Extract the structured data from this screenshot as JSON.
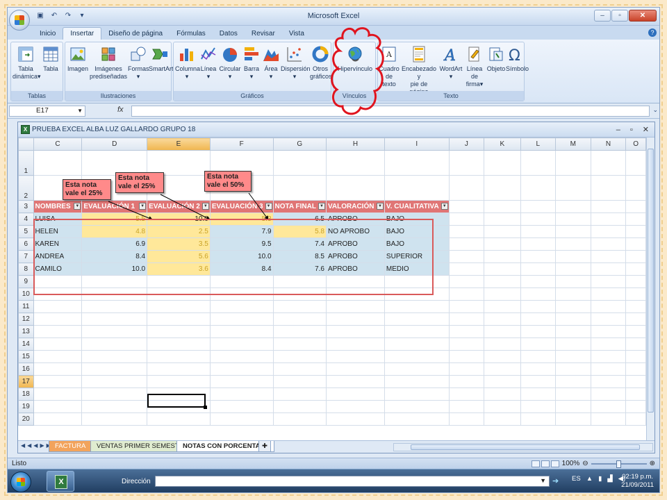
{
  "app": {
    "title": "Microsoft Excel"
  },
  "ribbon": {
    "tabs": [
      "Inicio",
      "Insertar",
      "Diseño de página",
      "Fórmulas",
      "Datos",
      "Revisar",
      "Vista"
    ],
    "active_tab": "Insertar",
    "groups": {
      "tablas": {
        "label": "Tablas",
        "buttons": [
          {
            "line1": "Tabla",
            "line2": "dinámica",
            "dd": "▾"
          },
          {
            "line1": "Tabla",
            "line2": "",
            "dd": ""
          }
        ]
      },
      "ilustraciones": {
        "label": "Ilustraciones",
        "buttons": [
          {
            "line1": "Imagen",
            "line2": "",
            "dd": ""
          },
          {
            "line1": "Imágenes",
            "line2": "prediseñadas",
            "dd": ""
          },
          {
            "line1": "Formas",
            "line2": "",
            "dd": "▾"
          },
          {
            "line1": "SmartArt",
            "line2": "",
            "dd": ""
          }
        ]
      },
      "graficos": {
        "label": "Gráficos",
        "buttons": [
          {
            "line1": "Columna",
            "line2": "",
            "dd": "▾"
          },
          {
            "line1": "Línea",
            "line2": "",
            "dd": "▾"
          },
          {
            "line1": "Circular",
            "line2": "",
            "dd": "▾"
          },
          {
            "line1": "Barra",
            "line2": "",
            "dd": "▾"
          },
          {
            "line1": "Área",
            "line2": "",
            "dd": "▾"
          },
          {
            "line1": "Dispersión",
            "line2": "",
            "dd": "▾"
          },
          {
            "line1": "Otros",
            "line2": "gráficos",
            "dd": "▾"
          }
        ]
      },
      "vinculos": {
        "label": "Vínculos",
        "buttons": [
          {
            "line1": "Hipervínculo",
            "line2": "",
            "dd": ""
          }
        ]
      },
      "texto": {
        "label": "Texto",
        "buttons": [
          {
            "line1": "Cuadro",
            "line2": "de texto",
            "dd": ""
          },
          {
            "line1": "Encabezado y",
            "line2": "pie de página",
            "dd": ""
          },
          {
            "line1": "WordArt",
            "line2": "",
            "dd": "▾"
          },
          {
            "line1": "Línea de",
            "line2": "firma",
            "dd": "▾"
          },
          {
            "line1": "Objeto",
            "line2": "",
            "dd": ""
          },
          {
            "line1": "Símbolo",
            "line2": "",
            "dd": ""
          }
        ]
      }
    }
  },
  "formula_bar": {
    "name_box": "E17",
    "fx": "fx",
    "content": ""
  },
  "workbook": {
    "title": "PRUEBA EXCEL ALBA LUZ GALLARDO GRUPO 18",
    "columns": [
      "C",
      "D",
      "E",
      "F",
      "G",
      "H",
      "I",
      "J",
      "K",
      "L",
      "M",
      "N",
      "O"
    ],
    "rows": [
      "1",
      "2",
      "3",
      "4",
      "5",
      "6",
      "7",
      "8",
      "9",
      "10",
      "11",
      "12",
      "13",
      "14",
      "15",
      "16",
      "17",
      "18",
      "19",
      "20"
    ],
    "selected_row": "17",
    "selected_col": "E",
    "table_headers": [
      "NOMBRES",
      "EVALUACIÓN 1",
      "EVALUACIÓN 2",
      "EVALUACIÓN 3",
      "NOTA FINAL",
      "VALORACIÓN",
      "V. CUALITATIVA"
    ],
    "table_rows": [
      [
        "LUISA",
        "5.5",
        "10.0",
        "5.3",
        "6.5",
        "APROBO",
        "BAJO"
      ],
      [
        "HELEN",
        "4.8",
        "2.5",
        "7.9",
        "5.8",
        "NO APROBO",
        "BAJO"
      ],
      [
        "KAREN",
        "6.9",
        "3.5",
        "9.5",
        "7.4",
        "APROBO",
        "BAJO"
      ],
      [
        "ANDREA",
        "8.4",
        "5.6",
        "10.0",
        "8.5",
        "APROBO",
        "SUPERIOR"
      ],
      [
        "CAMILO",
        "10.0",
        "3.6",
        "8.4",
        "7.6",
        "APROBO",
        "MEDIO"
      ]
    ],
    "callouts": [
      {
        "line1": "Esta nota",
        "line2": "vale el 25%"
      },
      {
        "line1": "Esta nota",
        "line2": "vale el 25%"
      },
      {
        "line1": "Esta nota",
        "line2": "vale el 50%"
      }
    ],
    "sheet_tabs": [
      "FACTURA",
      "VENTAS PRIMER SEMESTRE",
      "NOTAS CON PORCENTAJE"
    ],
    "active_sheet": "NOTAS CON PORCENTAJE"
  },
  "status_bar": {
    "status": "Listo",
    "zoom": "100%"
  },
  "taskbar": {
    "address_label": "Dirección",
    "language": "ES",
    "time": "02:19 p.m.",
    "date": "21/09/2011"
  },
  "colors": {
    "header_fill": "#e07575",
    "blue_fill": "#cfe3ef",
    "yellow_fill": "#ffe89a",
    "annotation_red": "#e0141e"
  }
}
